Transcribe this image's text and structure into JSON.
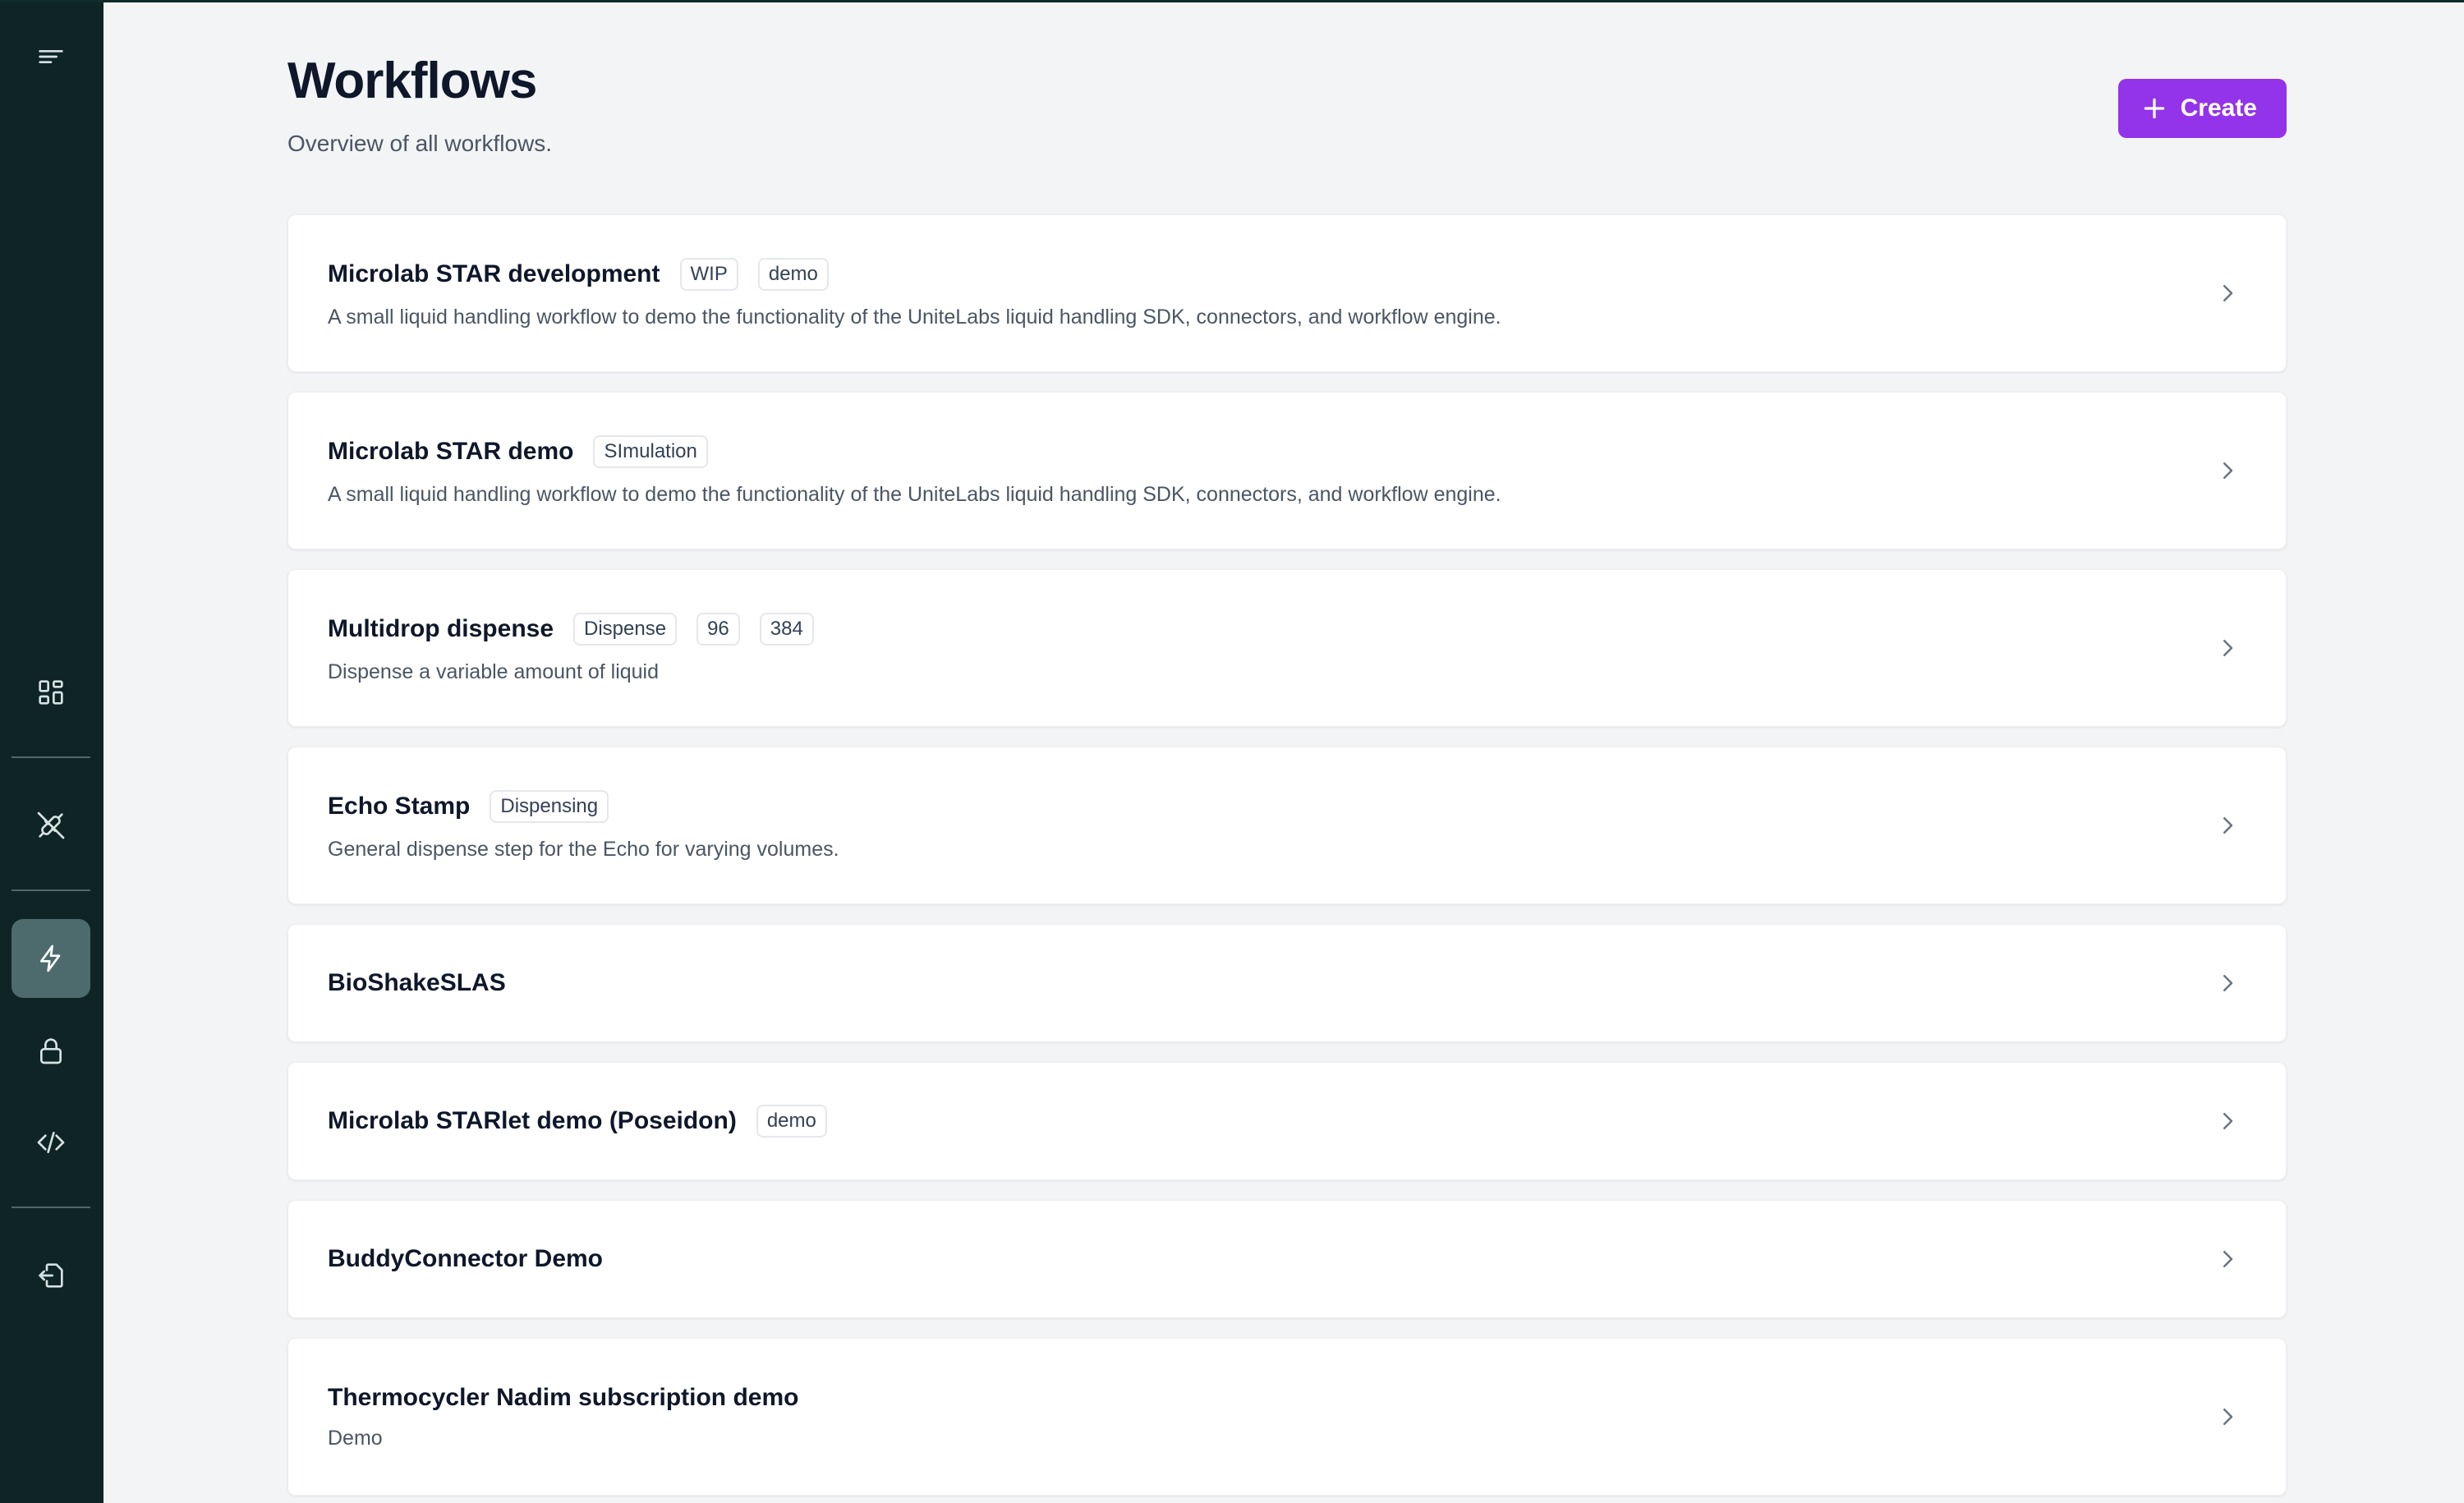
{
  "sidebar": {
    "items": [
      {
        "name": "menu-toggle",
        "icon": "menu-icon"
      },
      {
        "name": "dashboard",
        "icon": "grid-icon"
      },
      {
        "name": "connectors",
        "icon": "plug-off-icon"
      },
      {
        "name": "workflows",
        "icon": "lightning-icon",
        "active": true
      },
      {
        "name": "security",
        "icon": "lock-icon"
      },
      {
        "name": "developer",
        "icon": "code-icon"
      },
      {
        "name": "logout",
        "icon": "logout-icon"
      }
    ]
  },
  "header": {
    "title": "Workflows",
    "subtitle": "Overview of all workflows.",
    "create_label": "Create"
  },
  "accent": "#9333ea",
  "workflows": [
    {
      "title": "Microlab STAR development",
      "tags": [
        "WIP",
        "demo"
      ],
      "description": "A small liquid handling workflow to demo the functionality of the UniteLabs liquid handling SDK, connectors, and workflow engine."
    },
    {
      "title": "Microlab STAR demo",
      "tags": [
        "SImulation"
      ],
      "description": "A small liquid handling workflow to demo the functionality of the UniteLabs liquid handling SDK, connectors, and workflow engine."
    },
    {
      "title": "Multidrop dispense",
      "tags": [
        "Dispense",
        "96",
        "384"
      ],
      "description": "Dispense a variable amount of liquid"
    },
    {
      "title": "Echo Stamp",
      "tags": [
        "Dispensing"
      ],
      "description": "General dispense step for the Echo for varying volumes."
    },
    {
      "title": "BioShakeSLAS",
      "tags": [],
      "description": ""
    },
    {
      "title": "Microlab STARlet demo (Poseidon)",
      "tags": [
        "demo"
      ],
      "description": ""
    },
    {
      "title": "BuddyConnector Demo",
      "tags": [],
      "description": ""
    },
    {
      "title": "Thermocycler Nadim subscription demo",
      "tags": [],
      "description": "Demo"
    }
  ]
}
